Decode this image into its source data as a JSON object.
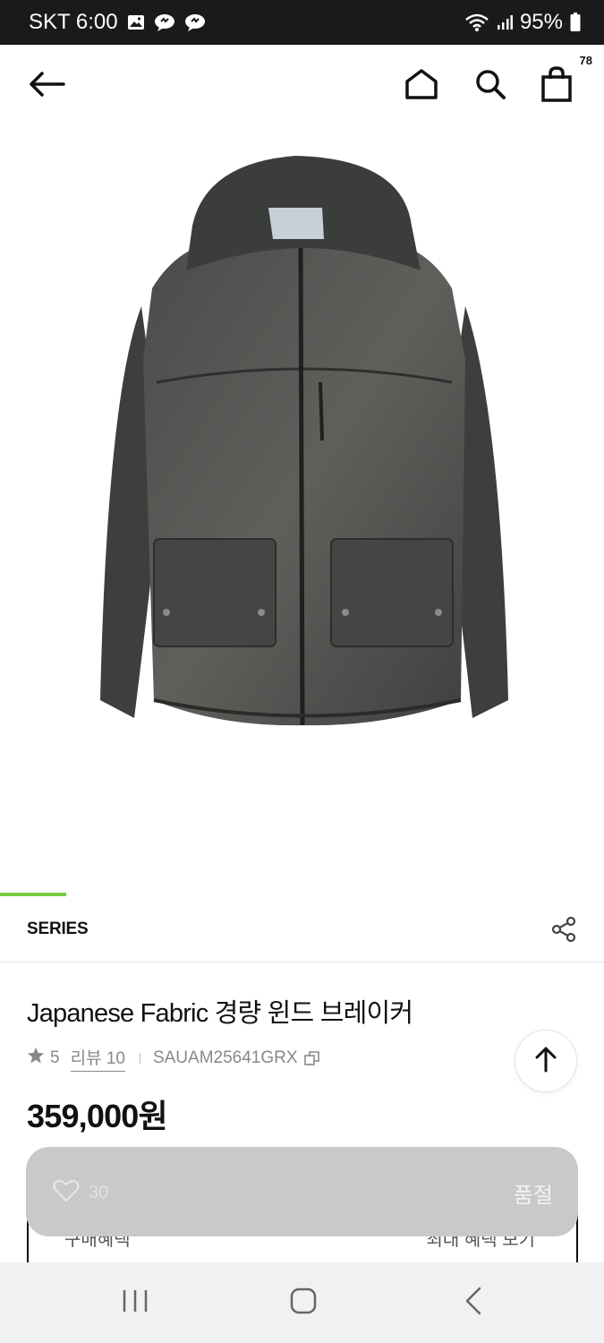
{
  "status_bar": {
    "carrier_time": "SKT 6:00",
    "battery": "95%",
    "icons": [
      "gallery-icon",
      "chat-bubble-icon",
      "chat-bubble-icon",
      "wifi-icon",
      "signal-icon",
      "battery-icon"
    ]
  },
  "header": {
    "cart_count": "78",
    "icons": [
      "back-arrow-icon",
      "home-icon",
      "search-icon",
      "shopping-bag-icon"
    ]
  },
  "gallery": {
    "image_subject": "charcoal hooded windbreaker jacket",
    "progress_fraction": 0.11,
    "accent_color": "#7ac943"
  },
  "brand": {
    "name": "SERIES",
    "share_icon": "share-icon"
  },
  "product": {
    "title": "Japanese Fabric 경량 윈드 브레이커",
    "rating": "5",
    "review_label": "리뷰 10",
    "sku": "SAUAM25641GRX",
    "price": "359,000원"
  },
  "coupon": {
    "left_text": "구매혜택",
    "right_text": "최대 혜택 보기"
  },
  "action_bar": {
    "like_count": "30",
    "status_label": "품절"
  },
  "nav_bar": {
    "icons": [
      "recent-apps-icon",
      "home-button-icon",
      "back-chevron-icon"
    ]
  }
}
